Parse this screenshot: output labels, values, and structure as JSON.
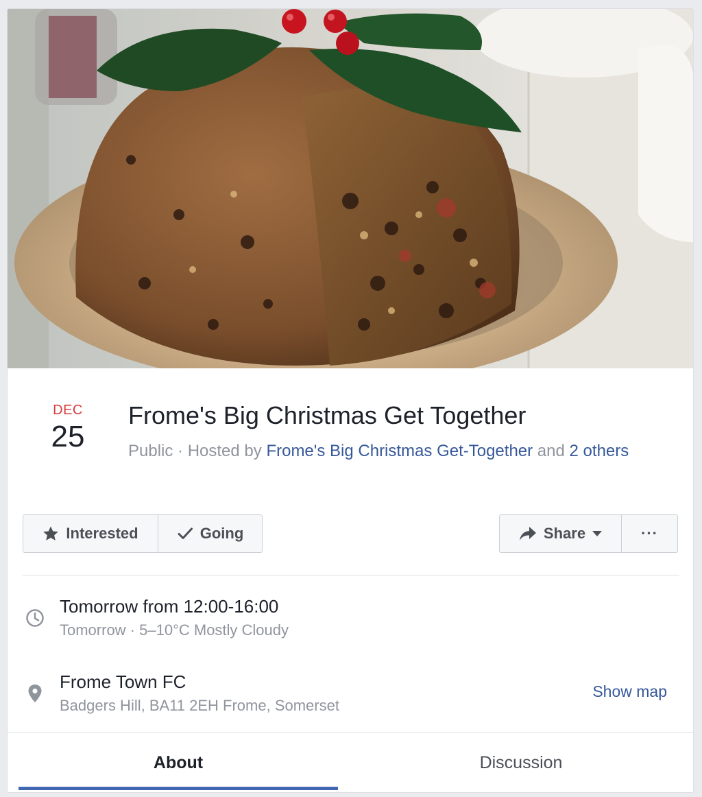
{
  "cover": {
    "alt": "cover-photo-christmas-pudding"
  },
  "event": {
    "month": "DEC",
    "day": "25",
    "title": "Frome's Big Christmas Get Together",
    "privacy": "Public",
    "separator": " · ",
    "hosted_by_prefix": "Hosted by ",
    "host": "Frome's Big Christmas Get-Together",
    "and_text": " and ",
    "others": "2 others"
  },
  "actions": {
    "interested": "Interested",
    "going": "Going",
    "share": "Share",
    "more": "···"
  },
  "details": {
    "time_main": "Tomorrow from 12:00-16:00",
    "time_sub": "Tomorrow · 5–10°C Mostly Cloudy",
    "place_name": "Frome Town FC",
    "place_address": "Badgers Hill, BA11 2EH Frome, Somerset",
    "show_map": "Show map"
  },
  "tabs": {
    "about": "About",
    "discussion": "Discussion",
    "active": "about"
  },
  "colors": {
    "date_month": "#d93c3c",
    "link": "#365899",
    "tab_indicator": "#4267b2"
  },
  "icons": {
    "interested": "star-icon",
    "going": "checkmark-icon",
    "share": "share-arrow-icon",
    "share_dropdown": "caret-down-icon",
    "time": "clock-icon",
    "place": "map-pin-icon"
  }
}
